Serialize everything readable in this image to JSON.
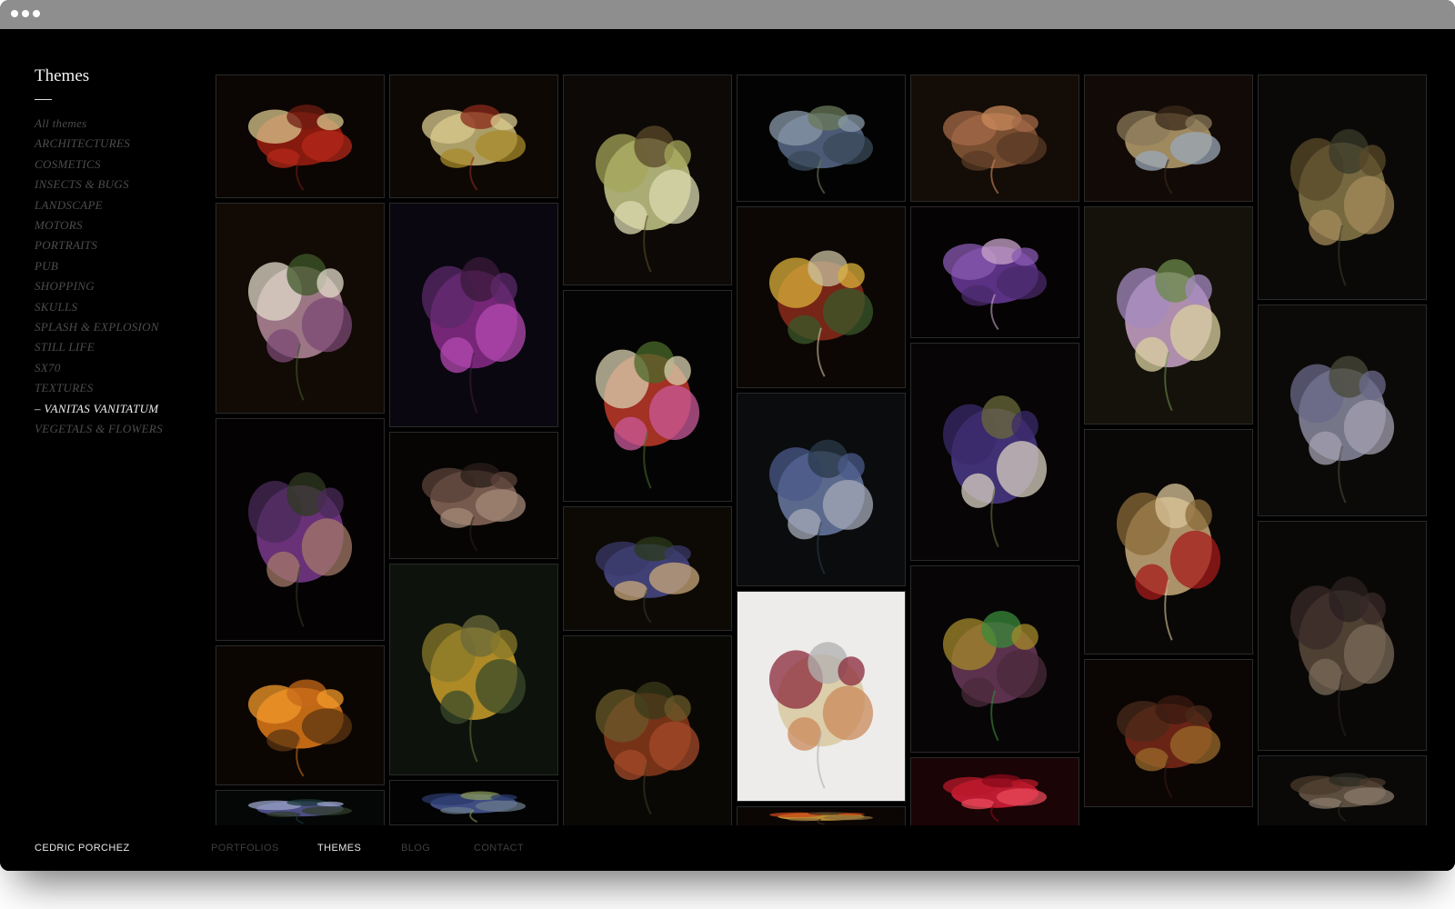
{
  "sidebar": {
    "title": "Themes",
    "items": [
      {
        "label": "All themes",
        "active": false
      },
      {
        "label": "ARCHITECTURES",
        "active": false
      },
      {
        "label": "COSMETICS",
        "active": false
      },
      {
        "label": "INSECTS & BUGS",
        "active": false
      },
      {
        "label": "LANDSCAPE",
        "active": false
      },
      {
        "label": "MOTORS",
        "active": false
      },
      {
        "label": "PORTRAITS",
        "active": false
      },
      {
        "label": "PUB",
        "active": false
      },
      {
        "label": "SHOPPING",
        "active": false
      },
      {
        "label": "SKULLS",
        "active": false
      },
      {
        "label": "SPLASH & EXPLOSION",
        "active": false
      },
      {
        "label": "STILL LIFE",
        "active": false
      },
      {
        "label": "SX70",
        "active": false
      },
      {
        "label": "TEXTURES",
        "active": false
      },
      {
        "label": "– VANITAS VANITATUM",
        "active": true
      },
      {
        "label": "VEGETALS & FLOWERS",
        "active": false
      }
    ]
  },
  "gallery": {
    "photos": [
      {
        "name": "photo-skull-red-flowers",
        "bg": "#0b0503",
        "colors": [
          "#9d1e10",
          "#d9c78d",
          "#b4281a",
          "#6f1c12"
        ]
      },
      {
        "name": "photo-pale-bouquet",
        "bg": "#120a04",
        "colors": [
          "#b58a9c",
          "#e0d9c9",
          "#7b4a74",
          "#3f5a2a"
        ]
      },
      {
        "name": "photo-hanging-purple-iris",
        "bg": "#040203",
        "colors": [
          "#7b3a8d",
          "#4a2b5a",
          "#a47a6a",
          "#2f3a22"
        ]
      },
      {
        "name": "photo-oranges-bowl",
        "bg": "#0c0603",
        "colors": [
          "#e07a18",
          "#f19a2a",
          "#5c3612",
          "#c56a18"
        ]
      },
      {
        "name": "photo-blue-blossoms",
        "bg": "#050707",
        "colors": [
          "#5a5a9a",
          "#9aa4c8",
          "#2f3d2a",
          "#1c3a3a"
        ]
      },
      {
        "name": "photo-skull-flowers-table",
        "bg": "#0d0804",
        "colors": [
          "#c9b97a",
          "#d9c98f",
          "#a88a2a",
          "#8a2a1a"
        ]
      },
      {
        "name": "photo-magenta-flowers",
        "bg": "#0a0710",
        "colors": [
          "#8a2b8a",
          "#5c2a6a",
          "#b44ab0",
          "#3a1a3a"
        ]
      },
      {
        "name": "photo-dry-lily",
        "bg": "#070404",
        "colors": [
          "#8a6a5a",
          "#5a4238",
          "#a48a78",
          "#2a1e1a"
        ]
      },
      {
        "name": "photo-yellow-vase",
        "bg": "#0e120c",
        "colors": [
          "#c9a02a",
          "#8a7a2a",
          "#3a4a2a",
          "#6a6a3a"
        ]
      },
      {
        "name": "photo-blue-iris",
        "bg": "#030303",
        "colors": [
          "#4a5a9a",
          "#2a3a6a",
          "#6a7a8a",
          "#8a9a5a"
        ]
      },
      {
        "name": "photo-skull-hydrangea",
        "bg": "#0c0906",
        "colors": [
          "#c7c98a",
          "#a4a65a",
          "#d9d9b0",
          "#5a4a2a"
        ]
      },
      {
        "name": "photo-red-bouquet",
        "bg": "#050404",
        "colors": [
          "#c03a2a",
          "#d9d0b0",
          "#c95a9a",
          "#4a6a2a"
        ]
      },
      {
        "name": "photo-purple-vase",
        "bg": "#0d0a06",
        "colors": [
          "#4a4a8a",
          "#3a3a6a",
          "#c9a87a",
          "#2a3a1a"
        ]
      },
      {
        "name": "photo-dried-bouquet",
        "bg": "#0a0805",
        "colors": [
          "#8a3a1a",
          "#6a5a2a",
          "#a44a2a",
          "#3a3a1a"
        ]
      },
      {
        "name": "photo-hanging-flower",
        "bg": "#030303",
        "colors": [
          "#5a6a8a",
          "#8a9aa8",
          "#3a4a5a",
          "#6a7a5a"
        ]
      },
      {
        "name": "photo-pomegranate-bowl",
        "bg": "#0c0704",
        "colors": [
          "#8a2a1a",
          "#d9b03a",
          "#3a5a2a",
          "#c9c0a0"
        ]
      },
      {
        "name": "photo-blue-lilac",
        "bg": "#0a0c0d",
        "colors": [
          "#6a7aa4",
          "#4a5a8a",
          "#a4aab8",
          "#2a3a4a"
        ]
      },
      {
        "name": "photo-skull-glass",
        "bg": "#eeecea",
        "colors": [
          "#d9c9a0",
          "#8a2a3a",
          "#c98a5a",
          "#b0b0b0"
        ]
      },
      {
        "name": "photo-pomegranate-split",
        "bg": "#0b0604",
        "colors": [
          "#d9a83a",
          "#c9451a",
          "#8a6a3a",
          "#3a2a1a"
        ]
      },
      {
        "name": "photo-dry-leaves",
        "bg": "#140c06",
        "colors": [
          "#8a5a3a",
          "#a46a48",
          "#5a3a24",
          "#c98a5a"
        ]
      },
      {
        "name": "photo-purple-dahlia",
        "bg": "#050304",
        "colors": [
          "#6a3a9a",
          "#8a5ab0",
          "#4a2a6a",
          "#c9a4c9"
        ]
      },
      {
        "name": "photo-skull-flowers-dark",
        "bg": "#070505",
        "colors": [
          "#4a3a8a",
          "#3a2a6a",
          "#d9d0c0",
          "#6a6a3a"
        ]
      },
      {
        "name": "photo-dry-twisted-flower",
        "bg": "#070506",
        "colors": [
          "#6a3a5a",
          "#a48a2a",
          "#4a2a3a",
          "#3a8a3a"
        ]
      },
      {
        "name": "photo-red-carnation",
        "bg": "#1a0406",
        "colors": [
          "#d9203a",
          "#b8182a",
          "#e84a5a",
          "#8a0a1a"
        ]
      },
      {
        "name": "photo-skull-goggles",
        "bg": "#120a06",
        "colors": [
          "#b8a070",
          "#8a7a5a",
          "#9aa8b8",
          "#3a2a1a"
        ]
      },
      {
        "name": "photo-pastel-bouquet",
        "bg": "#14120a",
        "colors": [
          "#c9a4c9",
          "#a48ac0",
          "#d9d0a0",
          "#6a8a4a"
        ]
      },
      {
        "name": "photo-skull-dried-flowers",
        "bg": "#0a0806",
        "colors": [
          "#c9aa7a",
          "#8a6a3a",
          "#a41a1a",
          "#d9c49a"
        ]
      },
      {
        "name": "photo-partial-bottom-1",
        "bg": "#0b0504",
        "colors": [
          "#7a2a1a",
          "#4a2a1a",
          "#9a6a2a",
          "#3a1a10"
        ]
      },
      {
        "name": "photo-partial-bottom-2",
        "bg": "#0b0907",
        "colors": [
          "#8a7a4a",
          "#5a4a2a",
          "#a48a5a",
          "#3a3a2a"
        ]
      },
      {
        "name": "photo-partial-bottom-3",
        "bg": "#0c0a08",
        "colors": [
          "#8a8aa0",
          "#6a6a8a",
          "#a4a0b0",
          "#4a4a3a"
        ]
      },
      {
        "name": "photo-partial-bottom-4",
        "bg": "#0a0807",
        "colors": [
          "#5a4a3a",
          "#3a2a2a",
          "#7a6a5a",
          "#2a2020"
        ]
      },
      {
        "name": "photo-partial-bottom-5",
        "bg": "#0a0908",
        "colors": [
          "#6a5a4a",
          "#4a3a2a",
          "#8a7a6a",
          "#2a2a20"
        ]
      }
    ]
  },
  "footer": {
    "brand": "CEDRIC PORCHEZ",
    "nav": [
      {
        "label": "PORTFOLIOS",
        "active": false
      },
      {
        "label": "THEMES",
        "active": true
      },
      {
        "label": "BLOG",
        "active": false
      },
      {
        "label": "CONTACT",
        "active": false
      }
    ]
  }
}
